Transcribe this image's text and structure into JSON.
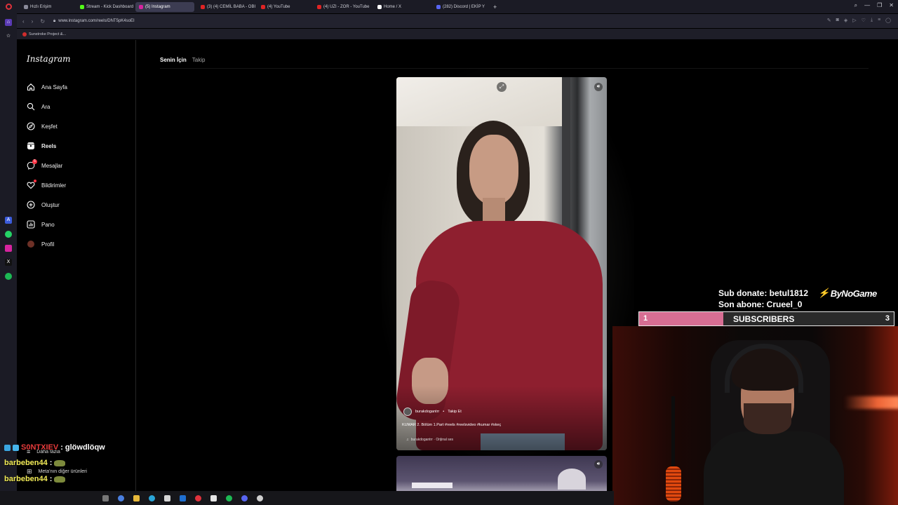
{
  "browser": {
    "tabs": [
      {
        "label": "Hızlı Erişim",
        "color": "#8a8a9a",
        "active": false
      },
      {
        "label": "Stream - Kick Dashboard",
        "color": "#53fc18",
        "active": false
      },
      {
        "label": "(5) Instagram",
        "color": "#d6249f",
        "active": true
      },
      {
        "label": "(3) (4) CEMİL BABA - OBI",
        "color": "#e02424",
        "active": false
      },
      {
        "label": "(4) YouTube",
        "color": "#e02424",
        "active": false
      },
      {
        "label": "(4) UZI - ZOR - YouTube",
        "color": "#e02424",
        "active": false
      },
      {
        "label": "Home / X",
        "color": "#ffffff",
        "active": false
      },
      {
        "label": "(282) Discord | EKİP Y",
        "color": "#5865f2",
        "active": false
      }
    ],
    "url": "www.instagram.com/reels/DNT5pK4soEI",
    "bookmark": "Sunstroke Project &..."
  },
  "instagram": {
    "logo": "Instagram",
    "nav": [
      {
        "label": "Ana Sayfa",
        "icon": "home-icon",
        "name": "nav-home"
      },
      {
        "label": "Ara",
        "icon": "search-icon",
        "name": "nav-search"
      },
      {
        "label": "Keşfet",
        "icon": "compass-icon",
        "name": "nav-explore"
      },
      {
        "label": "Reels",
        "icon": "reels-icon",
        "name": "nav-reels"
      },
      {
        "label": "Mesajlar",
        "icon": "messenger-icon",
        "name": "nav-messages",
        "badge": "5"
      },
      {
        "label": "Bildirimler",
        "icon": "heart-icon",
        "name": "nav-notifications"
      },
      {
        "label": "Oluştur",
        "icon": "plus-square-icon",
        "name": "nav-create"
      },
      {
        "label": "Pano",
        "icon": "chart-icon",
        "name": "nav-dashboard"
      },
      {
        "label": "Profil",
        "icon": "avatar-icon",
        "name": "nav-profile"
      }
    ],
    "more": [
      {
        "label": "Daha fazla",
        "icon": "menu-icon"
      },
      {
        "label": "Meta'nın diğer ürünleri",
        "icon": "grid-icon"
      }
    ],
    "feed_tabs": {
      "for_you": "Senin İçin",
      "following": "Takip"
    },
    "reel": {
      "username": "burakdogantrr",
      "separator": "•",
      "follow": "Takip Et",
      "caption": "KUMAR 2. Bölüm 1.Part #reels #reelsvideo #kumar #skeç",
      "audio": "burakdogantrr · Orijinal ses"
    }
  },
  "stream": {
    "sub_donate": "Sub donate: betul1812",
    "son_abone": "Son abone: Crueel_0",
    "brand": "ByNoGame",
    "subgoal": {
      "start": "1",
      "label": "SUBSCRIBERS",
      "goal": "3",
      "progress": 0.33
    }
  },
  "chat": [
    {
      "name": "S0NTXIEV",
      "message": ": glöwdlöqw",
      "color": "red",
      "emote": false
    },
    {
      "name": "barbeben44",
      "message": ":",
      "color": "yellow",
      "emote": true
    },
    {
      "name": "barbeben44",
      "message": ":",
      "color": "yellow",
      "emote": true
    },
    {
      "name": "barbeben44",
      "message": ":",
      "color": "yellow",
      "emote": true
    }
  ],
  "colors": {
    "accent_pink": "#d76e93",
    "ig_badge": "#ff3040"
  }
}
